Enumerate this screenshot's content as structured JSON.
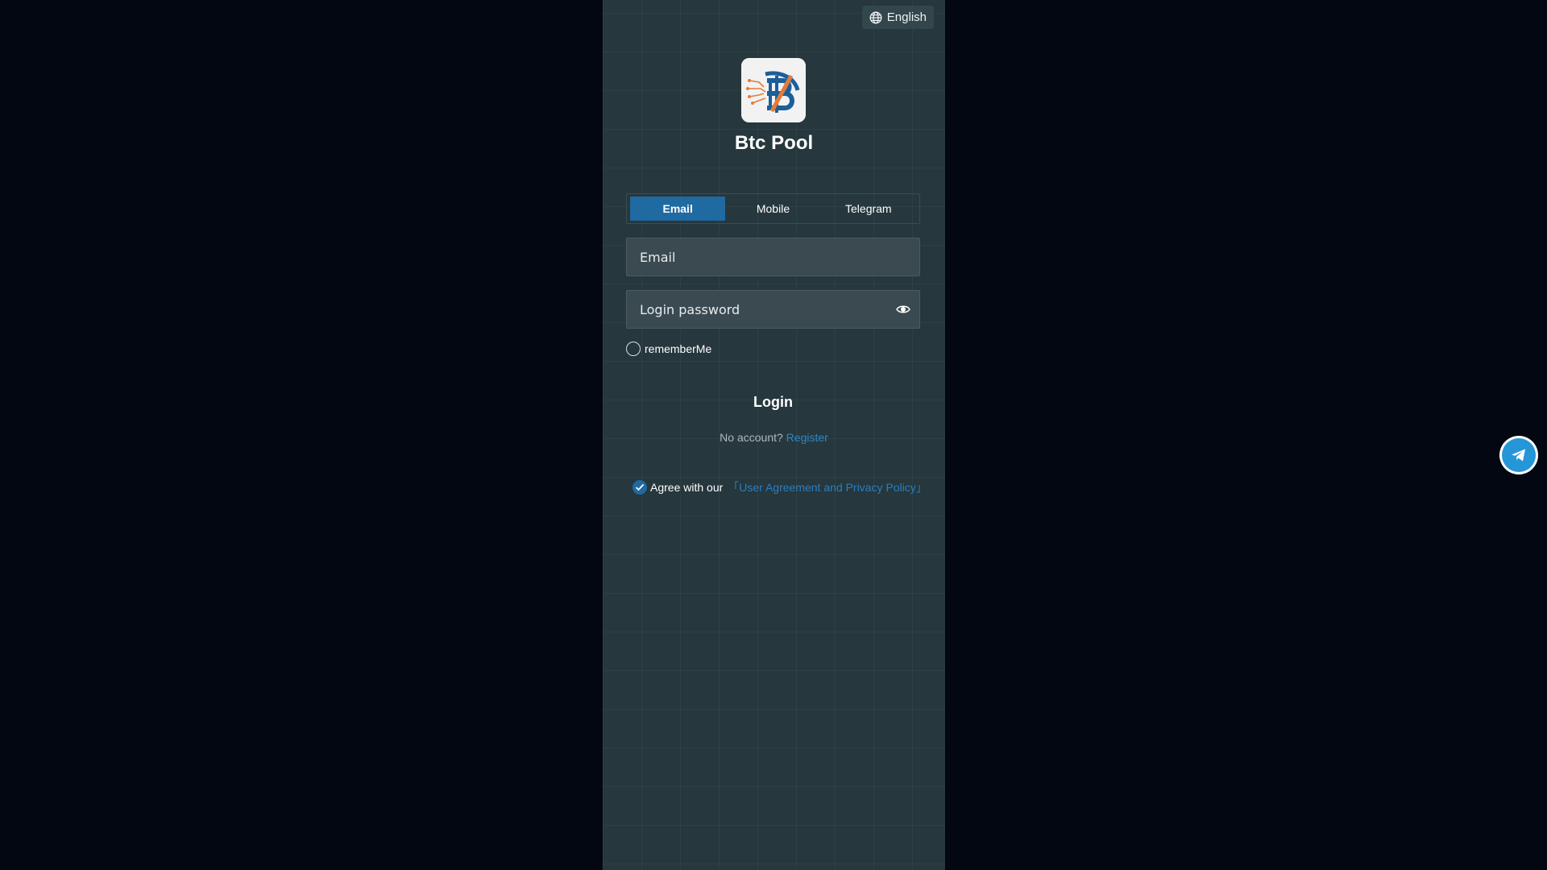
{
  "language": {
    "label": "English",
    "icon": "globe-icon"
  },
  "brand": {
    "name": "Btc Pool",
    "logo": "bitcoin-logo",
    "accent": "#1f6aa0",
    "link_color": "#2b87c9"
  },
  "tabs": [
    {
      "label": "Email",
      "active": true
    },
    {
      "label": "Mobile",
      "active": false
    },
    {
      "label": "Telegram",
      "active": false
    }
  ],
  "form": {
    "email_placeholder": "Email",
    "email_value": "",
    "password_placeholder": "Login password",
    "password_value": "",
    "password_toggle_icon": "eye-icon",
    "remember_label": "rememberMe",
    "remember_checked": false,
    "login_label": "Login"
  },
  "register": {
    "prompt": "No account?",
    "link": "Register"
  },
  "agreement": {
    "checked": true,
    "prefix": "Agree with our",
    "link": "「User Agreement and Privacy Policy」"
  },
  "floating": {
    "icon": "telegram-icon"
  }
}
